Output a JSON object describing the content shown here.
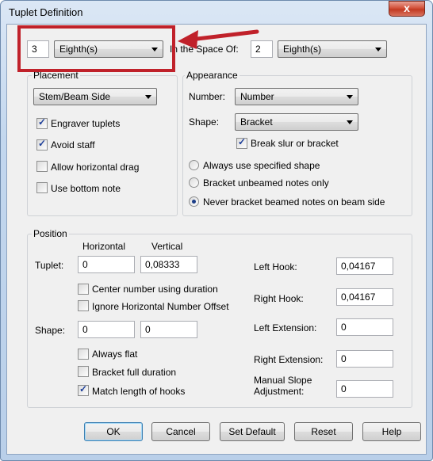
{
  "window": {
    "title": "Tuplet Definition",
    "close_glyph": "x"
  },
  "top": {
    "count": "3",
    "unit": "Eighth(s)",
    "space_label": "In the Space Of:",
    "space_count": "2",
    "space_unit": "Eighth(s)"
  },
  "placement": {
    "label": "Placement",
    "mode": "Stem/Beam Side",
    "engraver": "Engraver tuplets",
    "avoid": "Avoid staff",
    "horiz_drag": "Allow horizontal drag",
    "bottom_note": "Use bottom note"
  },
  "appearance": {
    "label": "Appearance",
    "number_label": "Number:",
    "number_value": "Number",
    "shape_label": "Shape:",
    "shape_value": "Bracket",
    "break_slur": "Break slur or bracket",
    "always": "Always use specified shape",
    "unbeamed": "Bracket unbeamed notes only",
    "never": "Never bracket beamed notes on beam side"
  },
  "position": {
    "label": "Position",
    "horizontal": "Horizontal",
    "vertical": "Vertical",
    "tuplet_label": "Tuplet:",
    "tuplet_h": "0",
    "tuplet_v": "0,08333",
    "center_number": "Center number using duration",
    "ignore_offset": "Ignore Horizontal Number Offset",
    "shape_label": "Shape:",
    "shape_h": "0",
    "shape_v": "0",
    "always_flat": "Always flat",
    "full_duration": "Bracket full duration",
    "match_hooks": "Match length of hooks",
    "left_hook_label": "Left Hook:",
    "left_hook": "0,04167",
    "right_hook_label": "Right Hook:",
    "right_hook": "0,04167",
    "left_ext_label": "Left Extension:",
    "left_ext": "0",
    "right_ext_label": "Right Extension:",
    "right_ext": "0",
    "slope_label_1": "Manual Slope",
    "slope_label_2": "Adjustment:",
    "slope": "0"
  },
  "buttons": {
    "ok": "OK",
    "cancel": "Cancel",
    "set_default": "Set Default",
    "reset": "Reset",
    "help": "Help"
  },
  "colors": {
    "annotation": "#c0212a"
  }
}
